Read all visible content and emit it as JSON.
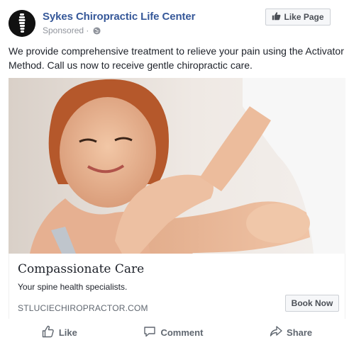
{
  "post": {
    "page_name": "Sykes Chiropractic Life Center",
    "sponsored_label": "Sponsored",
    "sponsored_separator": "·",
    "like_page_label": "Like Page",
    "text": "We provide comprehensive treatment to relieve your pain using the Activator Method. Call us now to receive gentle chiropractic care."
  },
  "link_card": {
    "title": "Compassionate Care",
    "description": "Your spine health specialists.",
    "domain": "STLUCIECHIROPRACTOR.COM",
    "cta_label": "Book Now"
  },
  "actions": {
    "like": "Like",
    "comment": "Comment",
    "share": "Share"
  },
  "icons": {
    "avatar": "spine-logo-icon",
    "privacy": "globe-icon",
    "like_page": "thumbs-up-icon",
    "like": "thumbs-up-outline-icon",
    "comment": "comment-bubble-icon",
    "share": "share-arrow-icon"
  },
  "colors": {
    "page_name": "#365899",
    "secondary_text": "#90949c",
    "button_bg": "#f6f7f9",
    "action_text": "#606770"
  }
}
